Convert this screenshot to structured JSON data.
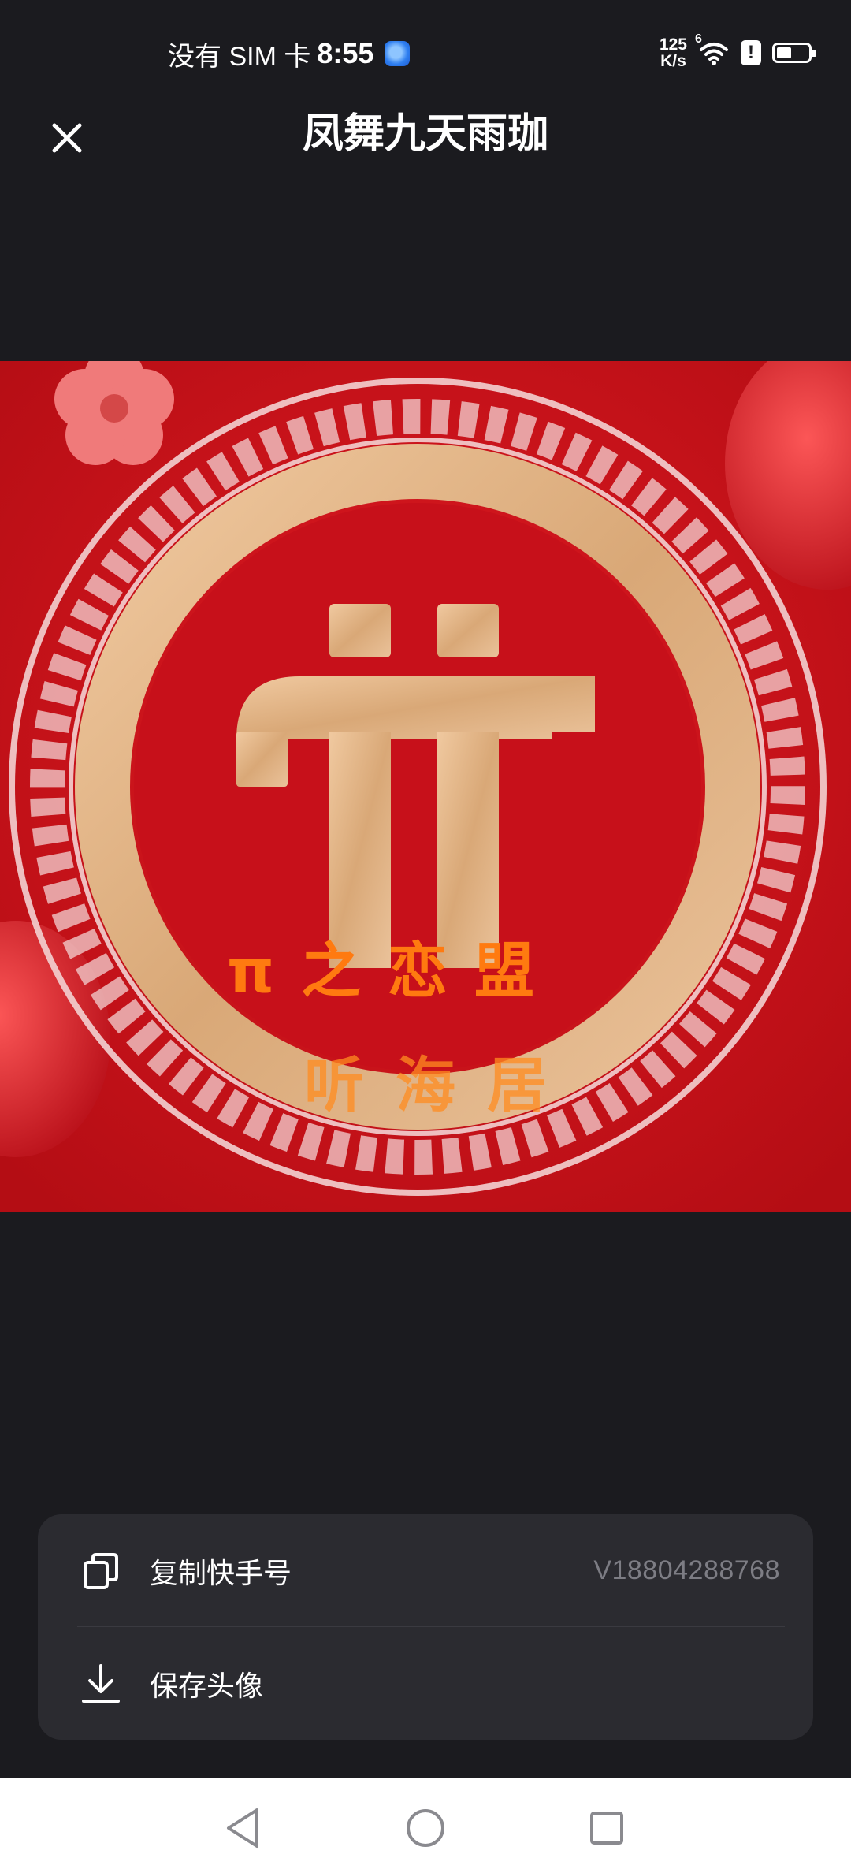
{
  "status_bar": {
    "carrier": "没有 SIM 卡",
    "time": "8:55",
    "net_speed_value": "125",
    "net_speed_unit": "K/s",
    "wifi_tag": "6",
    "alert_mark": "!",
    "battery_level": 0.4
  },
  "header": {
    "title": "凤舞九天雨珈",
    "close_icon": "close-icon"
  },
  "avatar": {
    "logo_text_line1": "π之恋盟",
    "logo_text_line2": "听海居"
  },
  "action_sheet": {
    "copy_label": "复制快手号",
    "copy_value": "V18804288768",
    "save_label": "保存头像"
  },
  "nav_bar": {
    "back_icon": "back-triangle-icon",
    "home_icon": "home-circle-icon",
    "recent_icon": "recent-square-icon"
  },
  "colors": {
    "background": "#1b1b1f",
    "sheet": "#2b2b30",
    "avatar_red": "#c8101a",
    "gold": "#e6b98a"
  }
}
